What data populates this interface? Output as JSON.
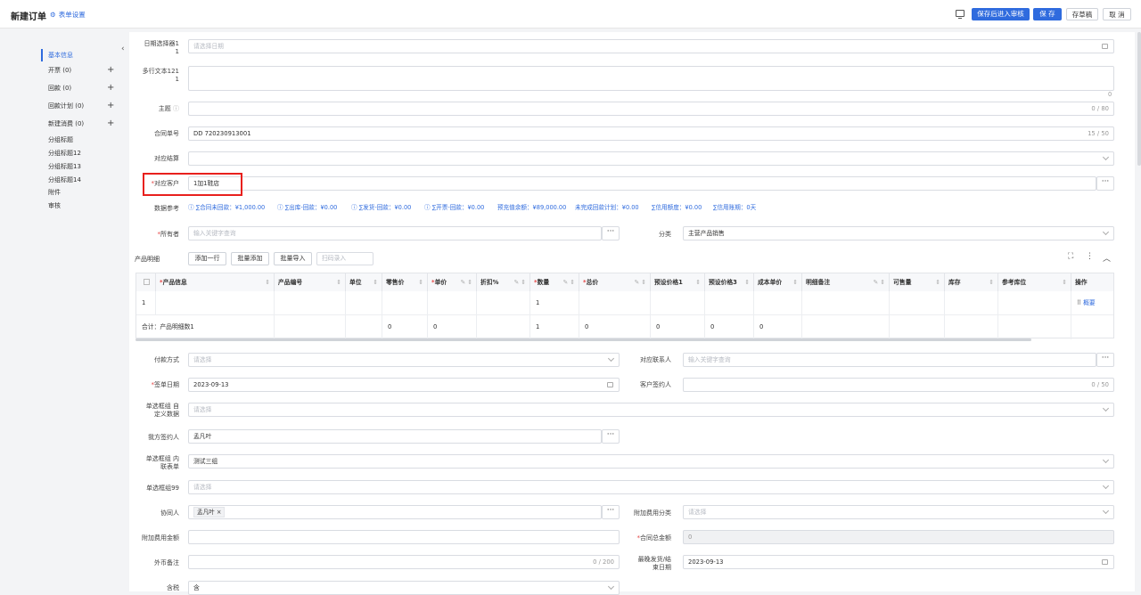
{
  "header": {
    "title": "新建订单",
    "form_settings": "表单设置",
    "buttons": {
      "save_review": "保存后进入审核",
      "save": "保 存",
      "draft": "存草稿",
      "cancel": "取 消"
    }
  },
  "sidebar": {
    "items": [
      {
        "label": "基本信息"
      },
      {
        "label": "开票  (0)"
      },
      {
        "label": "回款  (0)"
      },
      {
        "label": "回款计划  (0)"
      },
      {
        "label": "新建消费  (0)"
      },
      {
        "label": "分组标题"
      },
      {
        "label": "分组标题12"
      },
      {
        "label": "分组标题13"
      },
      {
        "label": "分组标题14"
      },
      {
        "label": "附件"
      },
      {
        "label": "审核"
      }
    ],
    "plus": "+"
  },
  "form": {
    "date_picker": {
      "label1": "日期选择器1",
      "label2": "1",
      "placeholder": "请选择日期"
    },
    "multiline": {
      "label1": "多行文本121",
      "label2": "1",
      "count": "0"
    },
    "subject": {
      "label": "主题",
      "count": "0 / 80"
    },
    "contract_no": {
      "label": "合同单号",
      "value": "DD 720230913001",
      "count": "15 / 50"
    },
    "settlement": {
      "label": "对应结算"
    },
    "customer": {
      "label": "对应客户",
      "value": "1加1鞋店"
    },
    "data_ref": {
      "label": "数据参考",
      "items": [
        "ⓘ ∑合同未回款：¥1,000.00",
        "ⓘ ∑出库-回款：¥0.00",
        "ⓘ ∑发货-回款：¥0.00",
        "ⓘ ∑开票-回款：¥0.00",
        "预充值余额：¥89,000.00",
        "未完成回款计划：¥0.00",
        "∑信用额度：¥0.00",
        "∑信用账期：0天"
      ]
    },
    "owner": {
      "label": "所有者",
      "placeholder": "输入关键字查询"
    },
    "category": {
      "label": "分类",
      "value": "主营产品销售"
    },
    "product": {
      "label": "产品明细",
      "add_row": "添加一行",
      "batch_add": "批量添加",
      "batch_import": "批量导入",
      "scan_placeholder": "扫码录入",
      "columns": [
        "产品信息",
        "产品编号",
        "单位",
        "零售价",
        "单价",
        "折扣%",
        "数量",
        "总价",
        "预设价格1",
        "预设价格3",
        "成本单价",
        "明细备注",
        "可售量",
        "库存",
        "参考库位",
        "操作"
      ],
      "row": {
        "index": "1",
        "qty": "1",
        "op": "概要"
      },
      "total": {
        "label": "合计：产品明细数1",
        "retail": "0",
        "price": "0",
        "qty": "1",
        "total": "0",
        "p1": "0",
        "p3": "0",
        "cost": "0"
      }
    },
    "payment": {
      "label": "付款方式",
      "placeholder": "请选择"
    },
    "contact": {
      "label": "对应联系人",
      "placeholder": "输入关键字查询"
    },
    "sign_date": {
      "label": "签单日期",
      "value": "2023-09-13"
    },
    "customer_signer": {
      "label": "客户签约人",
      "count": "0 / 50"
    },
    "single_custom": {
      "label1": "单选框组 自",
      "label2": "定义数据",
      "placeholder": "请选择"
    },
    "our_signer": {
      "label": "我方签约人",
      "value": "孟凡叶"
    },
    "single_inner": {
      "label1": "单选框组 内",
      "label2": "联表单",
      "value": "测试三组"
    },
    "single99": {
      "label": "单选框组99",
      "placeholder": "请选择"
    },
    "collaborator": {
      "label": "协同人",
      "tag": "孟凡叶 ×"
    },
    "extra_fee_cat": {
      "label": "附加费用分类",
      "placeholder": "请选择"
    },
    "extra_fee_amt": {
      "label": "附加费用金额"
    },
    "contract_total": {
      "label": "合同总金额",
      "value": "0"
    },
    "fx_note": {
      "label": "外币备注",
      "count": "0 / 200"
    },
    "latest_ship": {
      "label1": "最晚发货/结",
      "label2": "束日期",
      "value": "2023-09-13"
    },
    "tax": {
      "label": "含税",
      "value": "含"
    }
  }
}
